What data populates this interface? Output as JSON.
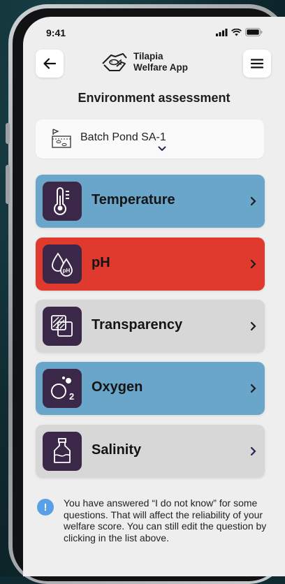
{
  "status": {
    "time": "9:41"
  },
  "header": {
    "app_name_line1": "Tilapia",
    "app_name_line2": "Welfare App",
    "back_icon": "arrow-left-icon",
    "menu_icon": "hamburger-menu-icon"
  },
  "page": {
    "title": "Environment assessment"
  },
  "pond": {
    "label": "Batch Pond SA-1",
    "icon": "pond-icon"
  },
  "cards": [
    {
      "label": "Temperature",
      "color": "#6aa6c9",
      "chevron_color": "#1b1b1b",
      "icon": "thermometer-icon"
    },
    {
      "label": "pH",
      "color": "#e03a2e",
      "chevron_color": "#1b1b1b",
      "icon": "ph-drops-icon"
    },
    {
      "label": "Transparency",
      "color": "#d7d7d8",
      "chevron_color": "#1b1b1b",
      "icon": "transparency-icon"
    },
    {
      "label": "Oxygen",
      "color": "#6aa6c9",
      "chevron_color": "#1b1b1b",
      "icon": "oxygen-icon"
    },
    {
      "label": "Salinity",
      "color": "#d7d7d8",
      "chevron_color": "#2c2350",
      "icon": "salinity-bottle-icon"
    }
  ],
  "notice": {
    "icon": "info-icon",
    "text": "You have answered “I do not know” for some questions. That will affect the reliability of your welfare score. You can still edit the question by clicking in the list above."
  }
}
